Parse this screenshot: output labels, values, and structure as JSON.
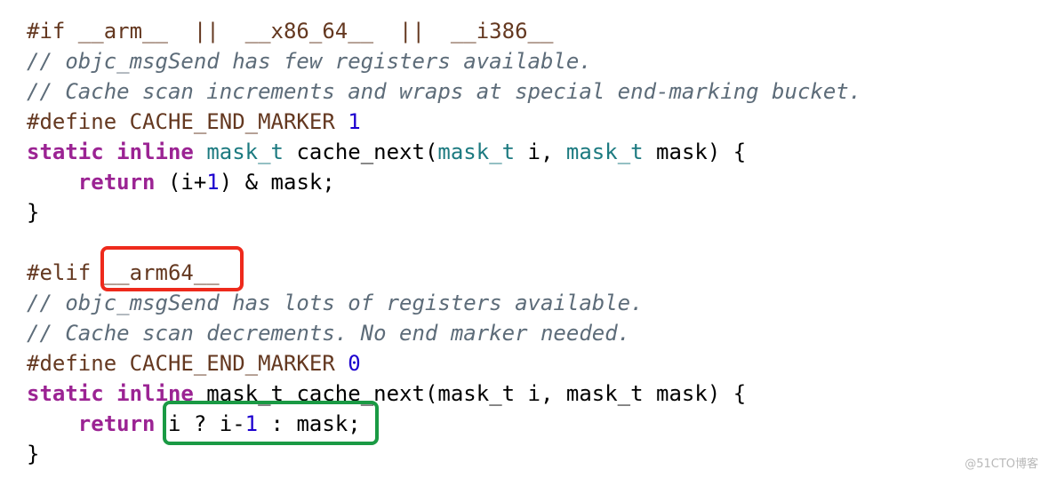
{
  "code_lines": [
    [
      [
        "pp",
        "#if __arm__  ||  __x86_64__  ||  __i386__"
      ]
    ],
    [
      [
        "cm",
        "// objc_msgSend has few registers available."
      ]
    ],
    [
      [
        "cm",
        "// Cache scan increments and wraps at special end-marking bucket."
      ]
    ],
    [
      [
        "pp",
        "#define CACHE_END_MARKER "
      ],
      [
        "num",
        "1"
      ]
    ],
    [
      [
        "kw",
        "static"
      ],
      [
        "pl",
        " "
      ],
      [
        "kw",
        "inline"
      ],
      [
        "pl",
        " "
      ],
      [
        "ty",
        "mask_t"
      ],
      [
        "pl",
        " cache_next("
      ],
      [
        "ty",
        "mask_t"
      ],
      [
        "pl",
        " i, "
      ],
      [
        "ty",
        "mask_t"
      ],
      [
        "pl",
        " mask) {"
      ]
    ],
    [
      [
        "pl",
        "    "
      ],
      [
        "kw",
        "return"
      ],
      [
        "pl",
        " (i+"
      ],
      [
        "num",
        "1"
      ],
      [
        "pl",
        ") & mask;"
      ]
    ],
    [
      [
        "pl",
        "}"
      ]
    ],
    [],
    [
      [
        "pp",
        "#elif __arm64__"
      ]
    ],
    [
      [
        "cm",
        "// objc_msgSend has lots of registers available."
      ]
    ],
    [
      [
        "cm",
        "// Cache scan decrements. No end marker needed."
      ]
    ],
    [
      [
        "pp",
        "#define CACHE_END_MARKER "
      ],
      [
        "num",
        "0"
      ]
    ],
    [
      [
        "kw",
        "static"
      ],
      [
        "pl",
        " "
      ],
      [
        "kw",
        "inline"
      ],
      [
        "pl",
        " mask_t cache_next(mask_t i, mask_t mask) {"
      ]
    ],
    [
      [
        "pl",
        "    "
      ],
      [
        "kw",
        "return"
      ],
      [
        "pl",
        " i ? i-"
      ],
      [
        "num",
        "1"
      ],
      [
        "pl",
        " : mask;"
      ]
    ],
    [
      [
        "pl",
        "}"
      ]
    ]
  ],
  "highlights": {
    "red_color": "#ee2a1c",
    "green_color": "#1a9a44"
  },
  "watermark": "@51CTO博客"
}
